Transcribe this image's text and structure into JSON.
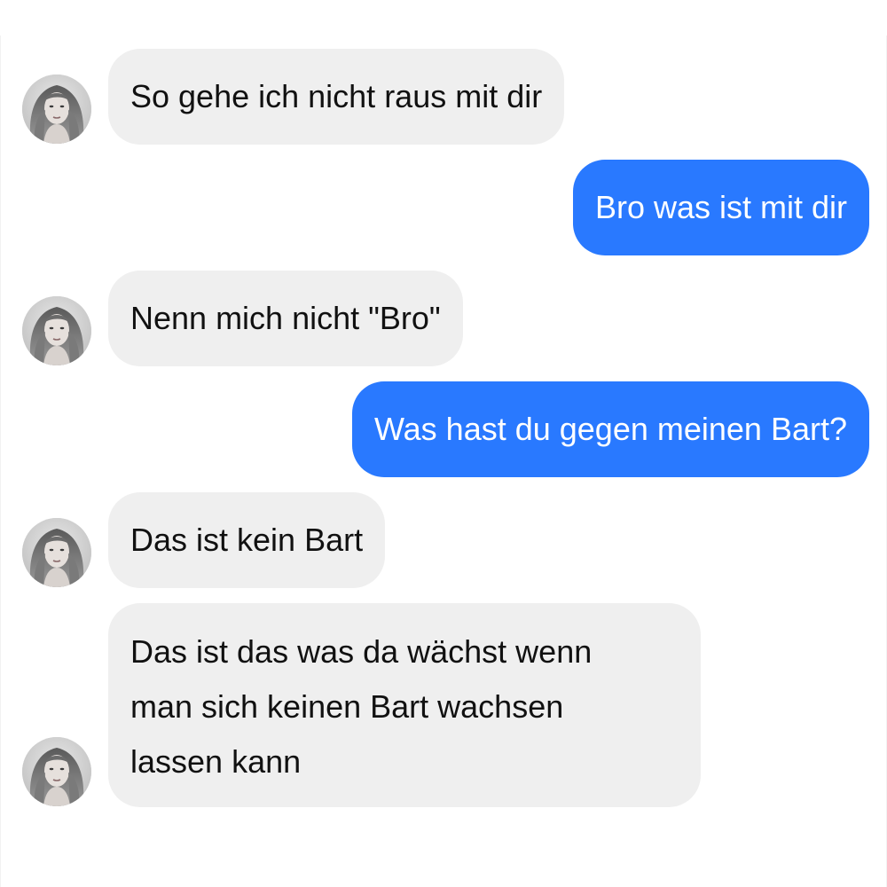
{
  "conversation": {
    "contact_avatar_icon": "profile-photo-woman-avatar",
    "colors": {
      "sent_bubble": "#2979ff",
      "received_bubble": "#efefef",
      "sent_text": "#ffffff",
      "received_text": "#111111"
    },
    "messages": [
      {
        "direction": "received",
        "text": "So gehe ich nicht raus mit dir"
      },
      {
        "direction": "sent",
        "text": "Bro was ist mit dir"
      },
      {
        "direction": "received",
        "text": "Nenn mich nicht \"Bro\""
      },
      {
        "direction": "sent",
        "text": "Was hast du gegen meinen Bart?"
      },
      {
        "direction": "received",
        "text": "Das ist kein Bart"
      },
      {
        "direction": "received",
        "lines": [
          "Das ist das was da wächst wenn",
          "man sich keinen Bart wachsen",
          "lassen kann"
        ]
      }
    ]
  }
}
